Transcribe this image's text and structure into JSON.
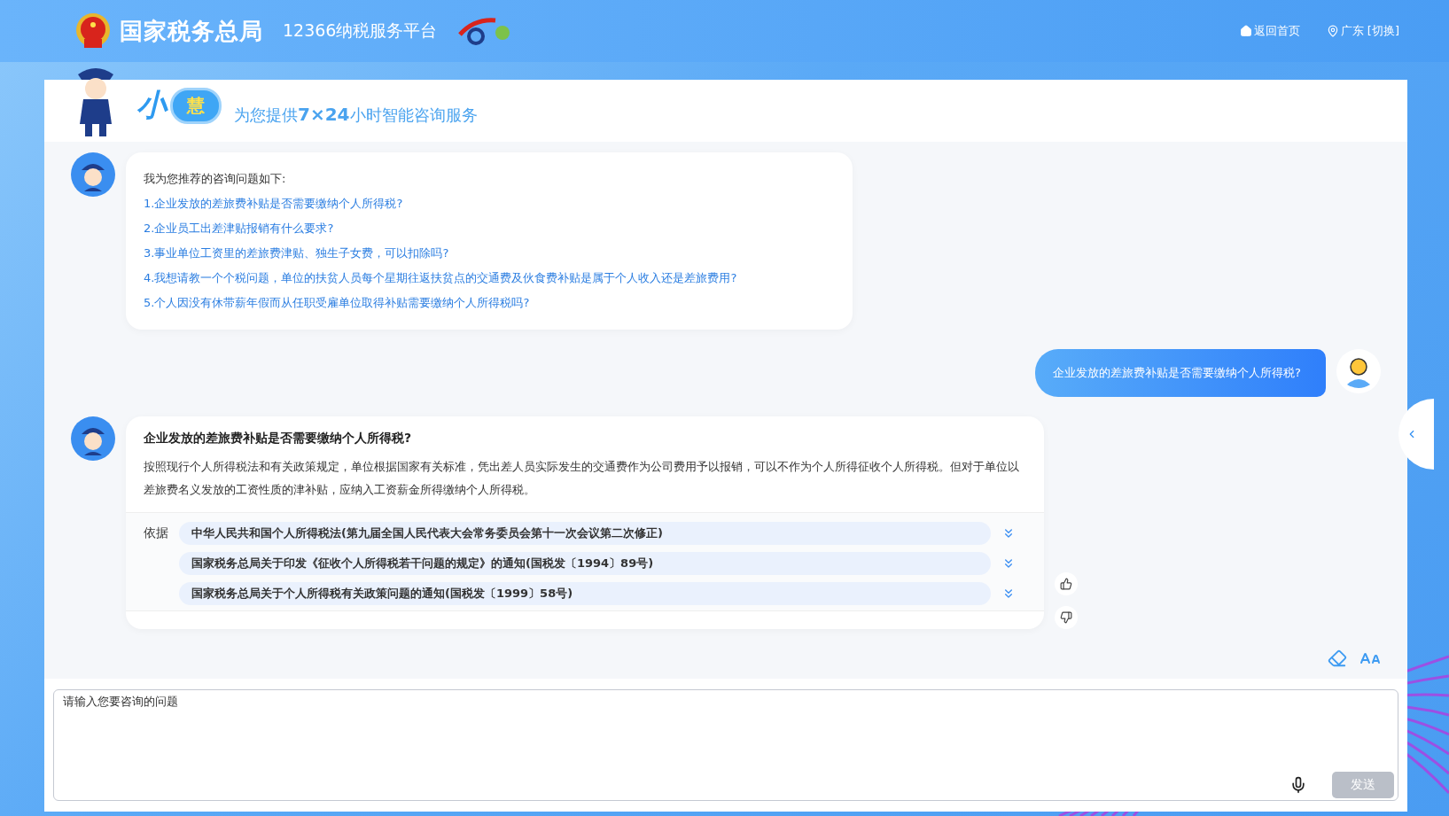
{
  "header": {
    "site_title": "国家税务总局",
    "platform_name": "12366纳税服务平台",
    "links": [
      {
        "kind": "home",
        "label": "返回首页"
      },
      {
        "kind": "location",
        "label": "广东 [切换]"
      }
    ]
  },
  "assistant": {
    "logo_chars": [
      "小",
      "慧"
    ],
    "tagline": "为您提供**7×24**小时智能咨询服务"
  },
  "messages": [
    {
      "kind": "recommend",
      "intro": "我为您推荐的咨询问题如下:",
      "questions": [
        "1.企业发放的差旅费补贴是否需要缴纳个人所得税?",
        "2.企业员工出差津贴报销有什么要求?",
        "3.事业单位工资里的差旅费津贴、独生子女费，可以扣除吗?",
        "4.我想请教一个个税问题，单位的扶贫人员每个星期往返扶贫点的交通费及伙食费补贴是属于个人收入还是差旅费用?",
        "5.个人因没有休带薪年假而从任职受雇单位取得补贴需要缴纳个人所得税吗?"
      ]
    },
    {
      "kind": "user",
      "text": "企业发放的差旅费补贴是否需要缴纳个人所得税?"
    },
    {
      "kind": "answer",
      "title": "企业发放的差旅费补贴是否需要缴纳个人所得税?",
      "body": "按照现行个人所得税法和有关政策规定，单位根据国家有关标准，凭出差人员实际发生的交通费作为公司费用予以报销，可以不作为个人所得征收个人所得税。但对于单位以差旅费名义发放的工资性质的津补贴，应纳入工资薪金所得缴纳个人所得税。",
      "basis_label": "依据",
      "references": [
        "中华人民共和国个人所得税法(第九届全国人民代表大会常务委员会第十一次会议第二次修正)",
        "国家税务总局关于印发《征收个人所得税若干问题的规定》的通知(国税发〔1994〕89号)",
        "国家税务总局关于个人所得税有关政策问题的通知(国税发〔1999〕58号)"
      ]
    }
  ],
  "input": {
    "placeholder": "请输入您要咨询的问题",
    "send_label": "发送"
  }
}
